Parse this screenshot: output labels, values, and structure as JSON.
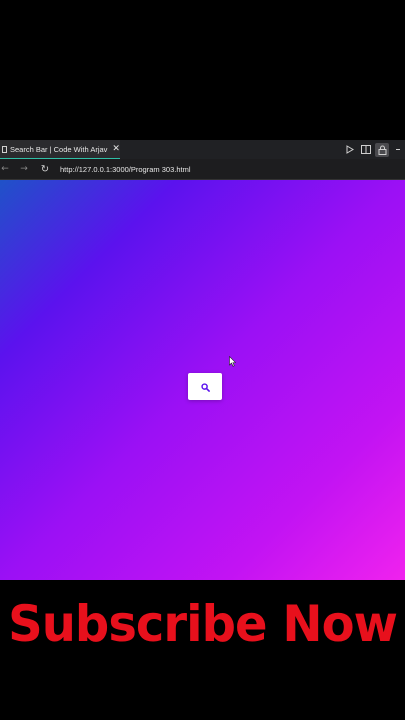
{
  "browser": {
    "tab": {
      "title": "Search Bar | Code With Arjav",
      "close_glyph": "✕"
    },
    "address": {
      "url": "http://127.0.0.1:3000/Program 303.html"
    },
    "nav": {
      "back_glyph": "←",
      "forward_glyph": "→",
      "reload_glyph": "↻"
    }
  },
  "page": {
    "background_gradient": [
      "#1f52c8",
      "#5b12ee",
      "#9b10f5",
      "#c313f3",
      "#f022ee"
    ],
    "search_button": {
      "icon": "search-icon",
      "icon_color": "#5b12ee"
    }
  },
  "overlay": {
    "subscribe_text": "Subscribe Now",
    "color": "#e8101c"
  }
}
